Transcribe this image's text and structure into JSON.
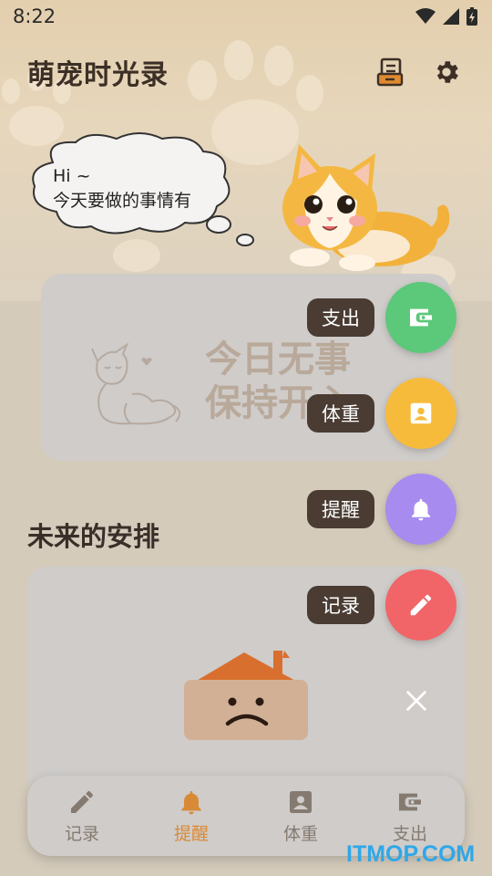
{
  "status_bar": {
    "time": "8:22",
    "icons": [
      "wifi-icon",
      "signal-icon",
      "battery-icon"
    ]
  },
  "header": {
    "title": "萌宠时光录",
    "icons": [
      "archive-box-icon",
      "gear-icon"
    ]
  },
  "greeting": {
    "line1": "Hi ~",
    "line2": "今天要做的事情有"
  },
  "today_card": {
    "empty_line1": "今日无事",
    "empty_line2": "保持开心"
  },
  "future": {
    "title": "未来的安排"
  },
  "fab_menu": {
    "items": [
      {
        "label": "支出",
        "icon": "wallet-icon",
        "color": "#5cc87a"
      },
      {
        "label": "体重",
        "icon": "contact-card-icon",
        "color": "#f7bb3c"
      },
      {
        "label": "提醒",
        "icon": "bell-icon",
        "color": "#a78bef"
      },
      {
        "label": "记录",
        "icon": "pencil-icon",
        "color": "#f16468"
      }
    ],
    "close_icon": "close-icon"
  },
  "bottom_nav": {
    "items": [
      {
        "label": "记录",
        "icon": "pencil-icon",
        "active": false
      },
      {
        "label": "提醒",
        "icon": "bell-icon",
        "active": true
      },
      {
        "label": "体重",
        "icon": "contact-card-icon",
        "active": false
      },
      {
        "label": "支出",
        "icon": "wallet-icon",
        "active": false
      }
    ],
    "active_color": "#d98a37",
    "inactive_color": "#857a70"
  },
  "watermark": "ITMOP.COM"
}
